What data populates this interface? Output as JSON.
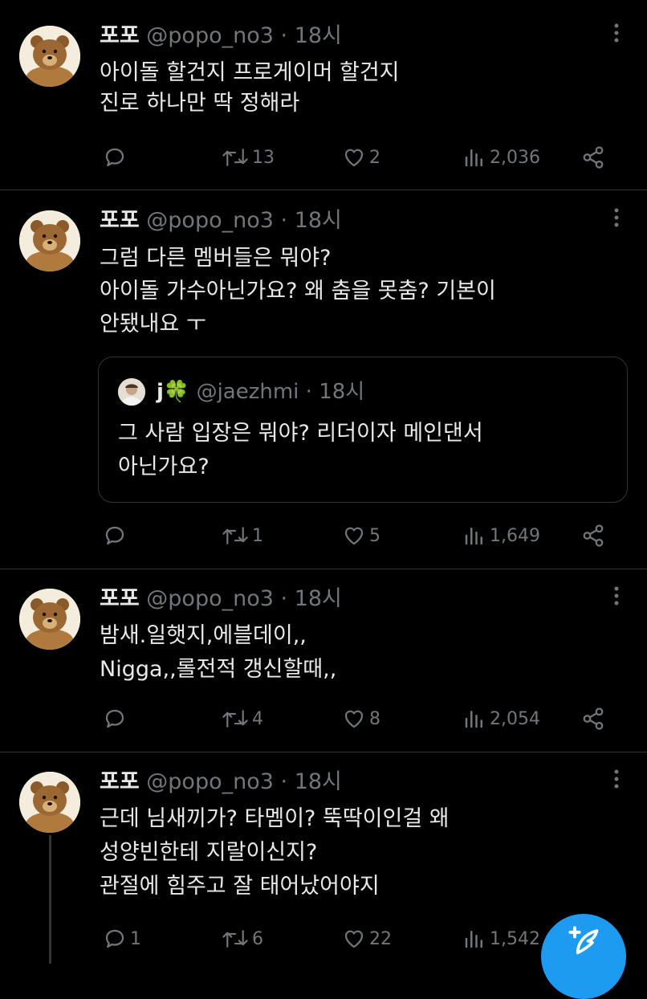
{
  "tweets": [
    {
      "name": "포포",
      "handle": "@popo_no3",
      "dot": "·",
      "time": "18시",
      "text": "아이돌 할건지 프로게이머 할건지\n진로 하나만 딱 정해라",
      "replies": "",
      "retweets": "13",
      "likes": "2",
      "views": "2,036"
    },
    {
      "name": "포포",
      "handle": "@popo_no3",
      "dot": "·",
      "time": "18시",
      "text": "그럼 다른 멤버들은 뭐야?\n아이돌 가수아닌가요? 왜 춤을 못춤? 기본이\n안됐내요 ㅜ",
      "quote": {
        "name": "j🍀",
        "handle": "@jaezhmi",
        "dot": "·",
        "time": "18시",
        "text": "그 사람 입장은 뭐야? 리더이자 메인댄서\n아닌가요?"
      },
      "replies": "",
      "retweets": "1",
      "likes": "5",
      "views": "1,649"
    },
    {
      "name": "포포",
      "handle": "@popo_no3",
      "dot": "·",
      "time": "18시",
      "text": "밤새.일햇지,에블데이,,\nNigga,,롤전적 갱신할때,,",
      "replies": "",
      "retweets": "4",
      "likes": "8",
      "views": "2,054"
    },
    {
      "name": "포포",
      "handle": "@popo_no3",
      "dot": "·",
      "time": "18시",
      "text": "근데 님새끼가? 타멤이? 뚝딱이인걸 왜\n성양빈한테 지랄이신지?\n관절에 힘주고 잘 태어났어야지",
      "replies": "1",
      "retweets": "6",
      "likes": "22",
      "views": "1,542"
    }
  ],
  "icons": {
    "reply": "reply-icon",
    "retweet": "retweet-icon",
    "like": "heart-icon",
    "views": "views-icon",
    "share": "share-icon",
    "more": "more-icon",
    "compose": "compose-icon"
  },
  "colors": {
    "background": "#000000",
    "text": "#e7e9ea",
    "muted": "#71767b",
    "divider": "#2f3336",
    "accent": "#1d9bf0"
  }
}
